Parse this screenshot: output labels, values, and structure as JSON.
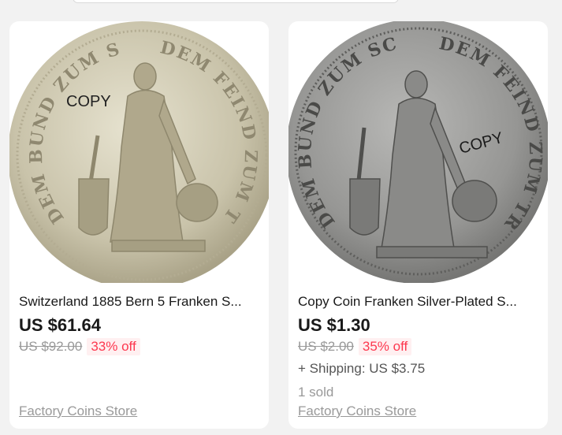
{
  "products": [
    {
      "title": "Switzerland 1885 Bern 5 Franken S...",
      "price": "US $61.64",
      "old_price": "US $92.00",
      "discount": "33% off",
      "store": "Factory Coins Store",
      "image": {
        "stamp": "COPY",
        "rim_left": "DEM BUND ZUM SCHUTZ",
        "rim_right": "DEM FEIND ZUM TRUTZ",
        "color": "#cfc9b2"
      }
    },
    {
      "title": "Copy Coin Franken Silver-Plated S...",
      "price": "US $1.30",
      "old_price": "US $2.00",
      "discount": "35% off",
      "shipping": "+ Shipping: US $3.75",
      "sold": "1 sold",
      "store": "Factory Coins Store",
      "image": {
        "stamp": "COPY",
        "rim_left": "DEM BUND ZUM SCHUTZ",
        "rim_right": "DEM FEIND ZUM TRUTZ",
        "color": "#9a9a98"
      }
    }
  ]
}
